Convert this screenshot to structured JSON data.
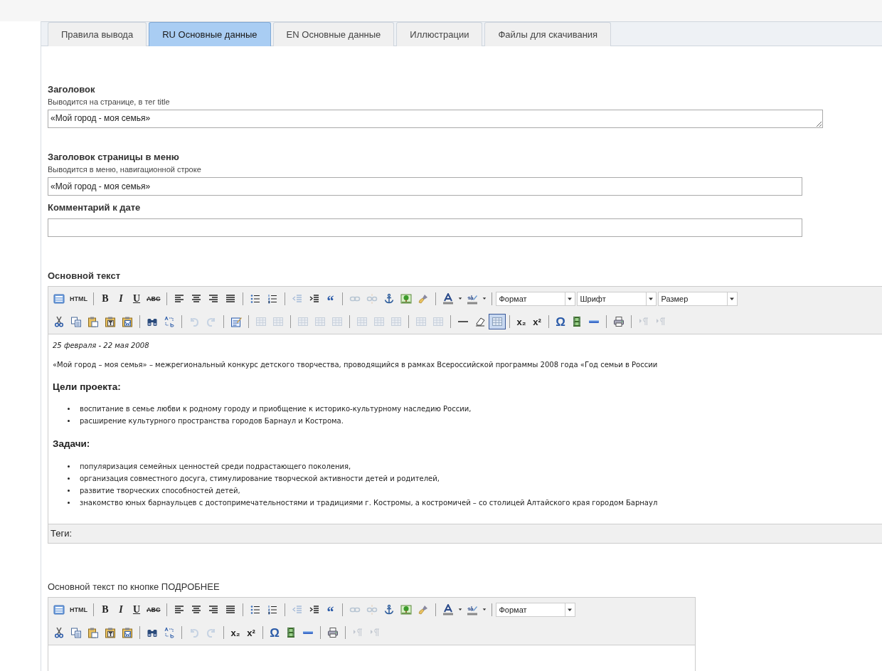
{
  "tabs": [
    {
      "label": "Правила вывода",
      "selected": false
    },
    {
      "label": "RU Основные данные",
      "selected": true
    },
    {
      "label": "EN Основные данные",
      "selected": false
    },
    {
      "label": "Иллюстрации",
      "selected": false
    },
    {
      "label": "Файлы для скачивания",
      "selected": false
    }
  ],
  "fields": [
    {
      "kind": "textarea",
      "label": "Заголовок",
      "hint": "Выводится на странице, в тег title",
      "value": "«Мой город - моя семья»"
    },
    {
      "kind": "input",
      "label": "Заголовок страницы в меню",
      "hint": "Выводится в меню, навигационной строке",
      "value": "«Мой город - моя семья»"
    },
    {
      "kind": "input",
      "label": "Комментарий к дате"
    }
  ],
  "editors": [
    {
      "label": "Основной текст",
      "toolbar": [
        [
          {
            "kind": "source"
          },
          {
            "kind": "html",
            "text": "HTML"
          },
          {
            "kind": "sep"
          },
          {
            "kind": "bold",
            "text": "B"
          },
          {
            "kind": "italic",
            "text": "I"
          },
          {
            "kind": "underline",
            "text": "U"
          },
          {
            "kind": "strike",
            "text": "ABC"
          },
          {
            "kind": "sep"
          },
          {
            "kind": "align-left"
          },
          {
            "kind": "align-center"
          },
          {
            "kind": "align-right"
          },
          {
            "kind": "align-justify"
          },
          {
            "kind": "sep"
          },
          {
            "kind": "bullets"
          },
          {
            "kind": "numbers"
          },
          {
            "kind": "sep"
          },
          {
            "kind": "outdent",
            "disabled": true
          },
          {
            "kind": "indent",
            "disabled": false
          },
          {
            "kind": "quote",
            "text": "“"
          },
          {
            "kind": "sep"
          },
          {
            "kind": "link",
            "disabled": true
          },
          {
            "kind": "unlink",
            "disabled": true
          },
          {
            "kind": "anchor"
          },
          {
            "kind": "image"
          },
          {
            "kind": "brush"
          },
          {
            "kind": "sep"
          },
          {
            "kind": "text-color"
          },
          {
            "kind": "caret"
          },
          {
            "kind": "highlight"
          },
          {
            "kind": "caret"
          },
          {
            "kind": "sep"
          },
          {
            "kind": "select",
            "text": "Формат"
          },
          {
            "kind": "select",
            "text": "Шрифт"
          },
          {
            "kind": "select",
            "text": "Размер"
          }
        ],
        [
          {
            "kind": "cut"
          },
          {
            "kind": "copy"
          },
          {
            "kind": "paste"
          },
          {
            "kind": "paste-text"
          },
          {
            "kind": "paste-word"
          },
          {
            "kind": "sep"
          },
          {
            "kind": "find"
          },
          {
            "kind": "replace"
          },
          {
            "kind": "sep"
          },
          {
            "kind": "undo",
            "disabled": true
          },
          {
            "kind": "redo",
            "disabled": true
          },
          {
            "kind": "sep"
          },
          {
            "kind": "edit-form"
          },
          {
            "kind": "sep"
          },
          {
            "kind": "grid",
            "disabled": true
          },
          {
            "kind": "grid",
            "disabled": true
          },
          {
            "kind": "sep"
          },
          {
            "kind": "grid",
            "disabled": true
          },
          {
            "kind": "grid",
            "disabled": true
          },
          {
            "kind": "grid",
            "disabled": true
          },
          {
            "kind": "sep"
          },
          {
            "kind": "grid",
            "disabled": true
          },
          {
            "kind": "grid",
            "disabled": true
          },
          {
            "kind": "grid",
            "disabled": true
          },
          {
            "kind": "sep"
          },
          {
            "kind": "grid",
            "disabled": true
          },
          {
            "kind": "grid",
            "disabled": true
          },
          {
            "kind": "sep"
          },
          {
            "kind": "rule"
          },
          {
            "kind": "eraser"
          },
          {
            "kind": "grid",
            "disabled": false,
            "selected": true
          },
          {
            "kind": "sep"
          },
          {
            "kind": "subscript",
            "text": "x₂"
          },
          {
            "kind": "superscript",
            "text": "x²"
          },
          {
            "kind": "sep"
          },
          {
            "kind": "omega",
            "text": "Ω"
          },
          {
            "kind": "film"
          },
          {
            "kind": "bar"
          },
          {
            "kind": "sep"
          },
          {
            "kind": "printer"
          },
          {
            "kind": "sep"
          },
          {
            "kind": "pilcrow",
            "disabled": true
          },
          {
            "kind": "pilcrow",
            "disabled": true
          }
        ]
      ],
      "content": [
        {
          "kind": "date",
          "text": "25 февраля - 22 мая 2008"
        },
        {
          "kind": "p",
          "text": "«Мой город – моя семья» – межрегиональный конкурс детского творчества, проводящийся в рамках Всероссийской программы 2008 года «Год семьи в России"
        },
        {
          "kind": "h",
          "text": "Цели проекта:"
        },
        {
          "kind": "ul",
          "items": [
            "воспитание в семье любви к родному городу и приобщение к историко-культурному наследию России,",
            "расширение культурного пространства городов Барнаул и Кострома."
          ]
        },
        {
          "kind": "h",
          "text": "Задачи:"
        },
        {
          "kind": "ul",
          "items": [
            "популяризация семейных ценностей среди подрастающего поколения,",
            "организация совместного досуга, стимулирование творческой активности детей и родителей,",
            "развитие творческих способностей детей,",
            "знакомство юных барнаульцев с достопримечательностями и традициями г. Костромы, а костромичей – со столицей Алтайского края городом Барнаул"
          ]
        }
      ],
      "footer": "Теги:"
    },
    {
      "label": "Основной текст по кнопке ПОДРОБНЕЕ",
      "toolbar": [
        [
          {
            "kind": "source"
          },
          {
            "kind": "html",
            "text": "HTML"
          },
          {
            "kind": "sep"
          },
          {
            "kind": "bold",
            "text": "B"
          },
          {
            "kind": "italic",
            "text": "I"
          },
          {
            "kind": "underline",
            "text": "U"
          },
          {
            "kind": "strike",
            "text": "ABC"
          },
          {
            "kind": "sep"
          },
          {
            "kind": "align-left"
          },
          {
            "kind": "align-center"
          },
          {
            "kind": "align-right"
          },
          {
            "kind": "align-justify"
          },
          {
            "kind": "sep"
          },
          {
            "kind": "bullets"
          },
          {
            "kind": "numbers"
          },
          {
            "kind": "sep"
          },
          {
            "kind": "outdent",
            "disabled": true
          },
          {
            "kind": "indent",
            "disabled": false
          },
          {
            "kind": "quote",
            "text": "“"
          },
          {
            "kind": "sep"
          },
          {
            "kind": "link",
            "disabled": true
          },
          {
            "kind": "unlink",
            "disabled": true
          },
          {
            "kind": "anchor"
          },
          {
            "kind": "image"
          },
          {
            "kind": "brush"
          },
          {
            "kind": "sep"
          },
          {
            "kind": "text-color"
          },
          {
            "kind": "caret"
          },
          {
            "kind": "highlight"
          },
          {
            "kind": "caret"
          },
          {
            "kind": "sep"
          },
          {
            "kind": "select",
            "text": "Формат"
          }
        ],
        [
          {
            "kind": "cut"
          },
          {
            "kind": "copy"
          },
          {
            "kind": "paste"
          },
          {
            "kind": "paste-text"
          },
          {
            "kind": "paste-word"
          },
          {
            "kind": "sep"
          },
          {
            "kind": "find"
          },
          {
            "kind": "replace"
          },
          {
            "kind": "sep"
          },
          {
            "kind": "undo",
            "disabled": true
          },
          {
            "kind": "redo",
            "disabled": true
          },
          {
            "kind": "sep"
          },
          {
            "kind": "subscript",
            "text": "x₂"
          },
          {
            "kind": "superscript",
            "text": "x²"
          },
          {
            "kind": "sep"
          },
          {
            "kind": "omega",
            "text": "Ω"
          },
          {
            "kind": "film"
          },
          {
            "kind": "bar"
          },
          {
            "kind": "sep"
          },
          {
            "kind": "printer"
          },
          {
            "kind": "sep"
          },
          {
            "kind": "pilcrow",
            "disabled": true
          },
          {
            "kind": "pilcrow",
            "disabled": true
          }
        ]
      ]
    }
  ]
}
